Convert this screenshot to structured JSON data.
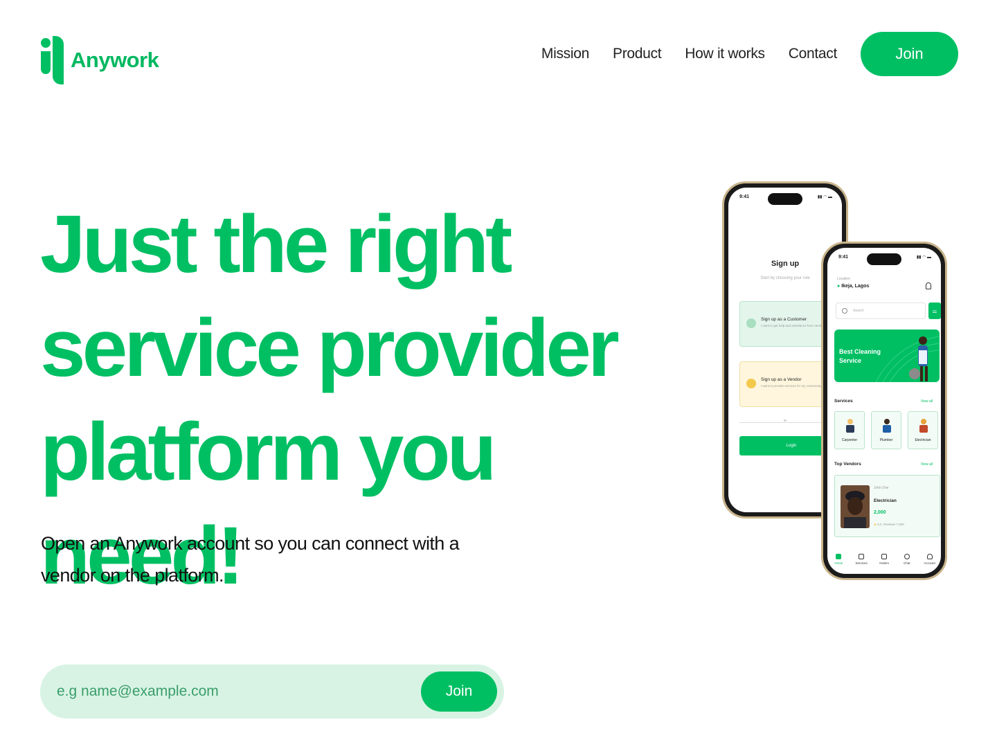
{
  "brand": {
    "name": "Anywork",
    "color": "#00bf63",
    "logo_icon": "anywork-logo-icon"
  },
  "nav": {
    "links": [
      "Mission",
      "Product",
      "How it works",
      "Contact"
    ],
    "join_label": "Join"
  },
  "hero": {
    "title_lines": [
      "Just the right",
      "service provider",
      "platform you need!"
    ],
    "subtitle": "Open an Anywork account so you can connect with a vendor on the platform."
  },
  "signup_form": {
    "email_placeholder": "e.g name@example.com",
    "join_label": "Join"
  },
  "phone_signup": {
    "time": "9:41",
    "title": "Sign up",
    "subtitle": "Start by choosing your role",
    "customer_title": "Sign up as a Customer",
    "customer_desc": "I want to get help and assistance from Vendor",
    "vendor_title": "Sign up as a Vendor",
    "vendor_desc": "I want to provide services for my community",
    "or": "or",
    "login": "Login"
  },
  "phone_home": {
    "time": "9:41",
    "location_label": "Location",
    "location_value": "Ikeja, Lagos",
    "search_placeholder": "Search",
    "banner_text": "Best Cleaning Service",
    "services_title": "Services",
    "view_all": "View all",
    "services": [
      "Carpenter",
      "Plumber",
      "Electrician"
    ],
    "top_vendors_title": "Top Vendors",
    "vendor": {
      "name": "John Doe",
      "role": "Electrician",
      "price": "2,000",
      "rating": "5.0",
      "reviews_label": "Reviews",
      "reviews": "7,000"
    },
    "tabs": [
      "Home",
      "Services",
      "Orders",
      "Chat",
      "Account"
    ],
    "active_tab": "Home"
  }
}
